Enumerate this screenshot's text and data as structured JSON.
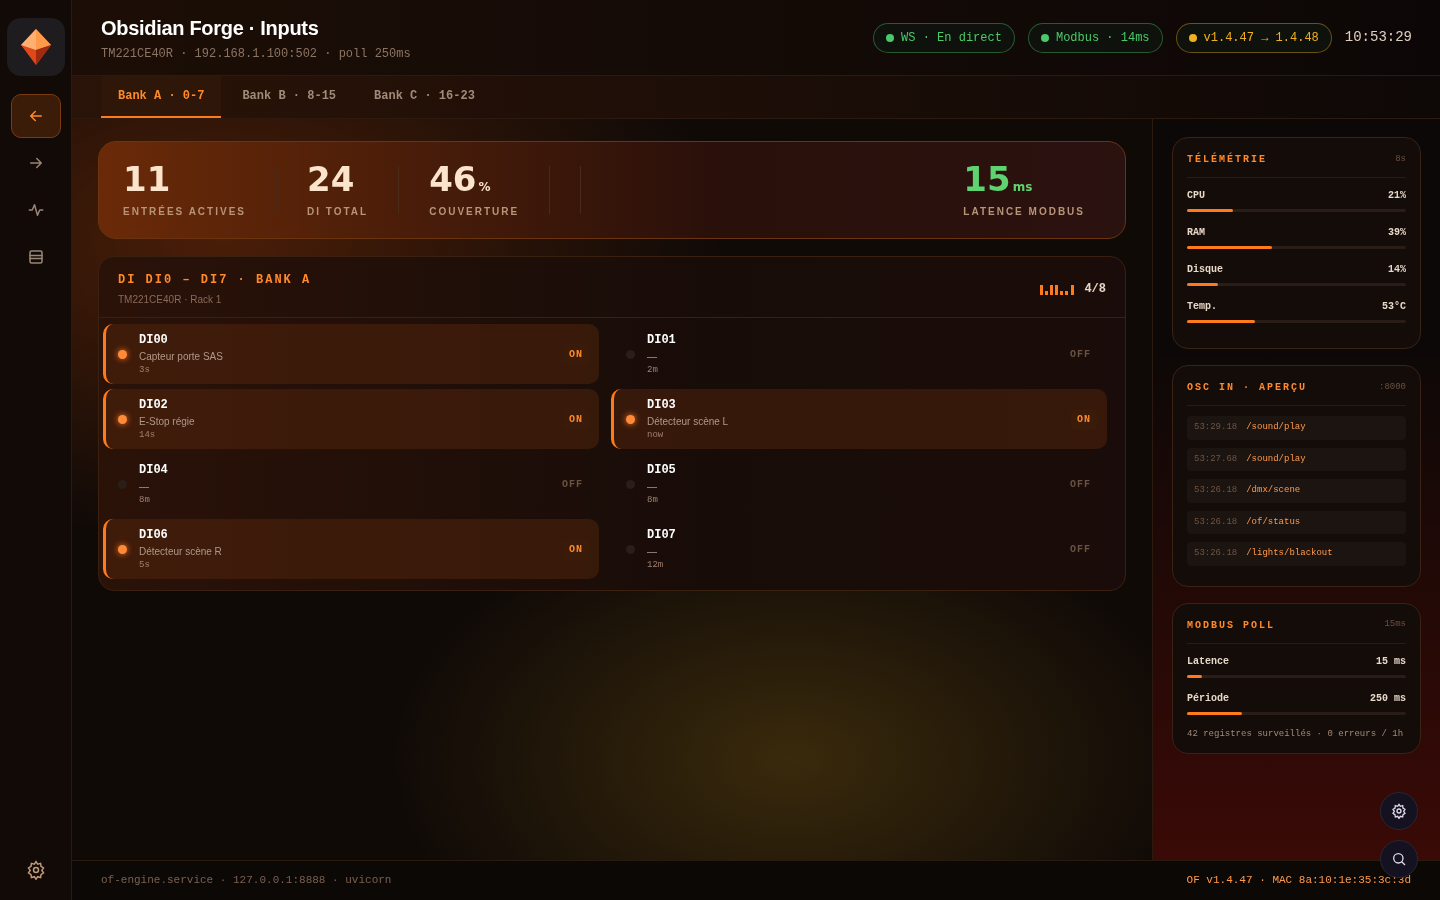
{
  "app": {
    "title": "Obsidian Forge · Inputs",
    "subtitle": "TM221CE40R · 192.168.1.100:502 · poll 250ms"
  },
  "sidebar": {
    "items": [
      {
        "kind": "back",
        "selected": true
      },
      {
        "kind": "forward",
        "selected": false
      },
      {
        "kind": "pulse",
        "selected": false
      },
      {
        "kind": "storage",
        "selected": false
      }
    ]
  },
  "status_pills": [
    {
      "text": "WS · En direct",
      "color": "#4cc86a"
    },
    {
      "text": "Modbus · 14ms",
      "color": "#4cc86a"
    },
    {
      "text": "v1.4.47 → 1.4.48",
      "color": "#f0b020"
    }
  ],
  "clock": "10:53:29",
  "tabs": [
    {
      "label": "Bank A · 0-7",
      "selected": true
    },
    {
      "label": "Bank B · 8-15",
      "selected": false
    },
    {
      "label": "Bank C · 16-23",
      "selected": false
    }
  ],
  "stats": [
    {
      "value": "11",
      "label": "ENTRÉES ACTIVES",
      "color": "#fbe3cc"
    },
    {
      "value": "24",
      "label": "DI TOTAL",
      "color": "#fbe3cc"
    },
    {
      "value": "46",
      "unit": "%",
      "label": "COUVERTURE",
      "color": "#fbe3cc"
    },
    {
      "value": "15",
      "unit": "ms",
      "label": "LATENCE MODBUS",
      "color": "#5fd36f"
    }
  ],
  "di_panel": {
    "title": "DI DI0 – DI7 · BANK A",
    "subtitle": "TM221CE40R · Rack 1",
    "count": "4/8",
    "inputs": [
      {
        "name": "DI00",
        "description": "Capteur porte SAS",
        "age": "3s",
        "state": "ON",
        "on": true
      },
      {
        "name": "DI01",
        "description": "—",
        "age": "2m",
        "state": "OFF",
        "on": false
      },
      {
        "name": "DI02",
        "description": "E-Stop régie",
        "age": "14s",
        "state": "ON",
        "on": true
      },
      {
        "name": "DI03",
        "description": "Détecteur scène L",
        "age": "now",
        "state": "ON",
        "on": true
      },
      {
        "name": "DI04",
        "description": "—",
        "age": "8m",
        "state": "OFF",
        "on": false
      },
      {
        "name": "DI05",
        "description": "—",
        "age": "8m",
        "state": "OFF",
        "on": false
      },
      {
        "name": "DI06",
        "description": "Détecteur scène R",
        "age": "5s",
        "state": "ON",
        "on": true
      },
      {
        "name": "DI07",
        "description": "—",
        "age": "12m",
        "state": "OFF",
        "on": false
      }
    ]
  },
  "telemetry": {
    "title": "TÉLÉMÉTRIE",
    "meta": "8s",
    "metrics": [
      {
        "label": "CPU",
        "reading": "21%",
        "level": 0.21
      },
      {
        "label": "RAM",
        "reading": "39%",
        "level": 0.39
      },
      {
        "label": "Disque",
        "reading": "14%",
        "level": 0.14
      },
      {
        "label": "Temp.",
        "reading": "53°C",
        "level": 0.31
      }
    ]
  },
  "osc": {
    "title": "OSC IN · APERÇU",
    "meta": ":8000",
    "messages": [
      {
        "time": "53:29.18",
        "path": "/sound/play"
      },
      {
        "time": "53:27.68",
        "path": "/sound/play"
      },
      {
        "time": "53:26.18",
        "path": "/dmx/scene"
      },
      {
        "time": "53:26.18",
        "path": "/of/status"
      },
      {
        "time": "53:26.18",
        "path": "/lights/blackout"
      }
    ]
  },
  "modbus_poll": {
    "title": "MODBUS POLL",
    "meta": "15ms",
    "metrics": [
      {
        "label": "Latence",
        "reading": "15 ms",
        "level": 0.07
      },
      {
        "label": "Période",
        "reading": "250 ms",
        "level": 0.25
      }
    ],
    "note": "42 registres surveillés · 0 erreurs / 1h"
  },
  "footer": {
    "left": "of-engine.service · 127.0.0.1:8888 · uvicorn",
    "right": "OF v1.4.47 · MAC 8a:10:1e:35:3c:3d"
  }
}
